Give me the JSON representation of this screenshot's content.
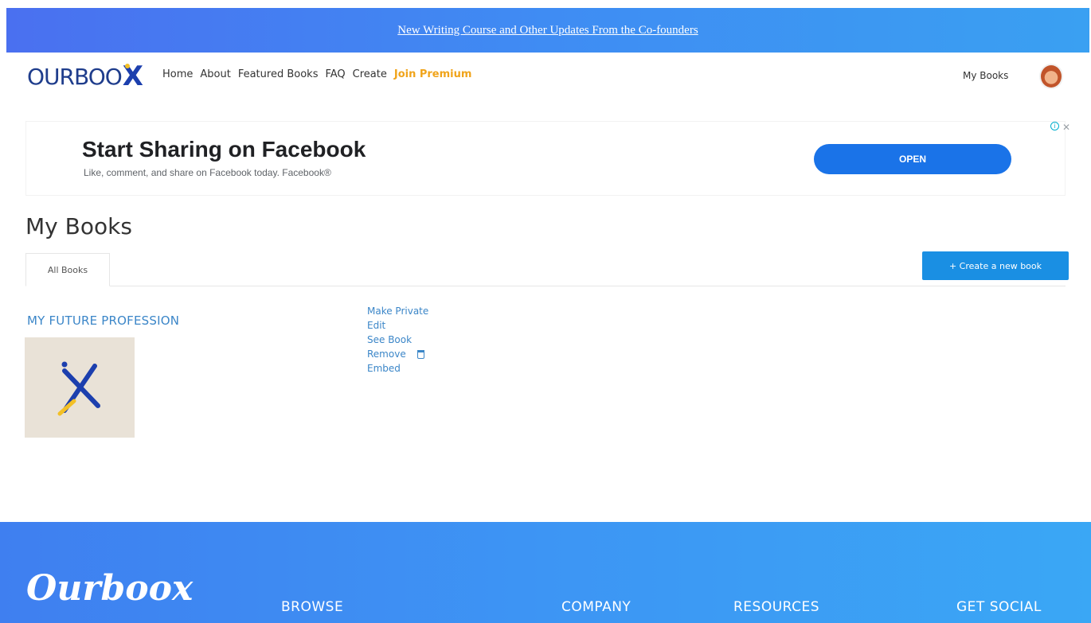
{
  "announcement": {
    "text": "New Writing Course and Other Updates From the Co-founders"
  },
  "nav": {
    "logo_text": "OURBOO",
    "logo_x": "X",
    "links": [
      "Home",
      "About",
      "Featured Books",
      "FAQ",
      "Create"
    ],
    "premium": "Join Premium",
    "my_books": "My Books"
  },
  "ad": {
    "title": "Start Sharing on Facebook",
    "subtitle": "Like, comment, and share on Facebook today. Facebook®",
    "button": "OPEN",
    "info_icon": "i",
    "close_icon": "✕"
  },
  "page": {
    "title": "My Books",
    "tab": "All Books",
    "create_button": "+ Create a new book"
  },
  "book": {
    "title": "MY FUTURE PROFESSION",
    "actions": {
      "make_private": "Make Private",
      "edit": "Edit",
      "see_book": "See Book",
      "remove": "Remove",
      "embed": "Embed"
    }
  },
  "footer": {
    "logo": "Ourboox",
    "columns": [
      "BROWSE",
      "COMPANY",
      "RESOURCES",
      "GET SOCIAL"
    ]
  },
  "colors": {
    "brand_blue": "#3f8cf3",
    "link_blue": "#3b86c8",
    "premium": "#f0a41b",
    "button_blue": "#1a8fe3"
  }
}
